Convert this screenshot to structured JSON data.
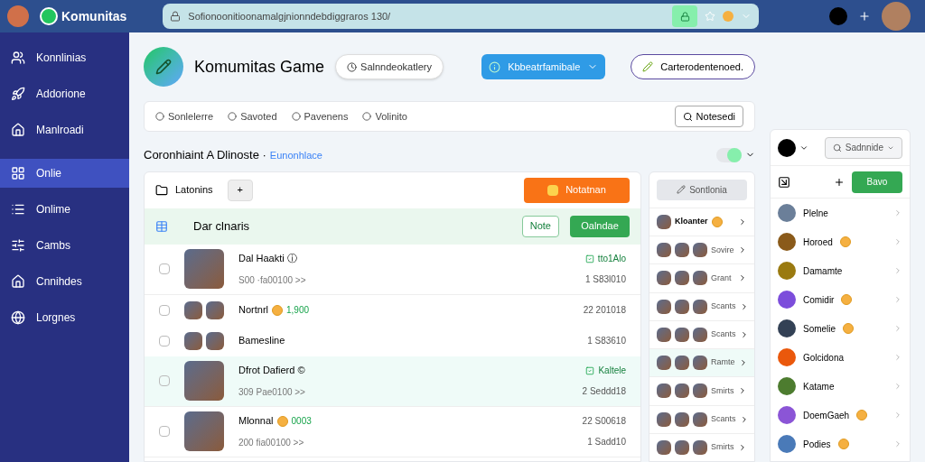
{
  "topbar": {
    "brand": "Komunitas",
    "url": "Sofionoonitioonamalgjnionndebdiggraros 130/"
  },
  "sidebar": {
    "items": [
      {
        "label": "Konnlinias",
        "selected": false
      },
      {
        "label": "Addorione",
        "selected": false
      },
      {
        "label": "Manlroadi",
        "selected": false
      },
      {
        "label": "Onlie",
        "selected": true
      },
      {
        "label": "Onlime",
        "selected": false
      },
      {
        "label": "Cambs",
        "selected": false
      },
      {
        "label": "Cnnihdes",
        "selected": false
      },
      {
        "label": "Lorgnes",
        "selected": false
      }
    ]
  },
  "header": {
    "title": "Komumitas Game",
    "pill": "Salnndeokatlery",
    "primary_button": "Kbbeatrfamibale",
    "outline_button": "Carterodentenoed."
  },
  "tabs": {
    "items": [
      {
        "label": "Sonlelerre",
        "selected": false
      },
      {
        "label": "Savoted",
        "selected": false
      },
      {
        "label": "Pavenens",
        "selected": false
      },
      {
        "label": "Volinito",
        "selected": false
      }
    ],
    "search_button": "Notesedi"
  },
  "section": {
    "title": "Coronhiaint A Dlinoste ·",
    "link": "Eunonhlace",
    "toggle_on": true
  },
  "main_card": {
    "title": "Latonins",
    "add_button": "+",
    "orange_button": "Notatnan",
    "band_title": "Dar clnaris",
    "note_button": "Note",
    "green_button": "Oalndae",
    "rows": [
      {
        "kind": "feature",
        "checked": false,
        "highlight": false,
        "title": "Dal Haakti ⓘ",
        "sub": "S00 ·fa00100 >>",
        "tag": "tto1Alo",
        "meta": "1 S83l010",
        "coin": false,
        "amount": ""
      },
      {
        "kind": "compact",
        "checked": false,
        "highlight": false,
        "title": "Nortnrl",
        "coin": true,
        "amount": "1,900",
        "meta": "22 201018"
      },
      {
        "kind": "compact",
        "checked": false,
        "highlight": false,
        "title": "Bamesline",
        "coin": false,
        "amount": "",
        "meta": "1 S83610"
      },
      {
        "kind": "feature",
        "checked": false,
        "highlight": true,
        "title": "Dfrot Dafierd ©",
        "sub": "309 Pae0100 >>",
        "tag": "Kaltele",
        "meta": "2 Seddd18",
        "coin": false,
        "amount": ""
      },
      {
        "kind": "feature",
        "checked": false,
        "highlight": false,
        "title": "Mlonnal",
        "sub": "200 fia00100 >>",
        "tag": "",
        "meta": "22 S00618",
        "meta2": "1 Sadd10",
        "coin": true,
        "amount": "0003"
      }
    ]
  },
  "middle": {
    "button": "Sontlonia",
    "items": [
      {
        "label": "Kloanter",
        "kind": "single",
        "bold": true,
        "coin": true,
        "highlight": false
      },
      {
        "label": "Sovire",
        "kind": "triple",
        "bold": false,
        "coin": false,
        "highlight": false
      },
      {
        "label": "Grant",
        "kind": "triple",
        "bold": false,
        "coin": false,
        "highlight": false
      },
      {
        "label": "Scants",
        "kind": "triple",
        "bold": false,
        "coin": false,
        "highlight": false
      },
      {
        "label": "Scants",
        "kind": "triple",
        "bold": false,
        "coin": false,
        "highlight": false
      },
      {
        "label": "Ramte",
        "kind": "triple",
        "bold": false,
        "coin": false,
        "highlight": true
      },
      {
        "label": "Smirts",
        "kind": "triple",
        "bold": false,
        "coin": false,
        "highlight": false
      },
      {
        "label": "Scants",
        "kind": "triple",
        "bold": false,
        "coin": false,
        "highlight": false
      },
      {
        "label": "Smirts",
        "kind": "triple",
        "bold": false,
        "coin": false,
        "highlight": false
      }
    ]
  },
  "right": {
    "search": "Sadnnide",
    "button": "Bavo",
    "items": [
      {
        "label": "Plelne",
        "coin": false,
        "color": "#6b7f99"
      },
      {
        "label": "Horoed",
        "coin": true,
        "color": "#8a5a1a"
      },
      {
        "label": "Damamte",
        "coin": false,
        "color": "#9a7a10"
      },
      {
        "label": "Comidir",
        "coin": true,
        "color": "#7c4ddb"
      },
      {
        "label": "Somelie",
        "coin": true,
        "color": "#334155"
      },
      {
        "label": "Golcidona",
        "coin": false,
        "color": "#ea580c"
      },
      {
        "label": "Katame",
        "coin": false,
        "color": "#4d7c2f"
      },
      {
        "label": "DoemGaeh",
        "coin": true,
        "color": "#8b55d6"
      },
      {
        "label": "Podies",
        "coin": true,
        "color": "#4a7ab8"
      }
    ]
  }
}
